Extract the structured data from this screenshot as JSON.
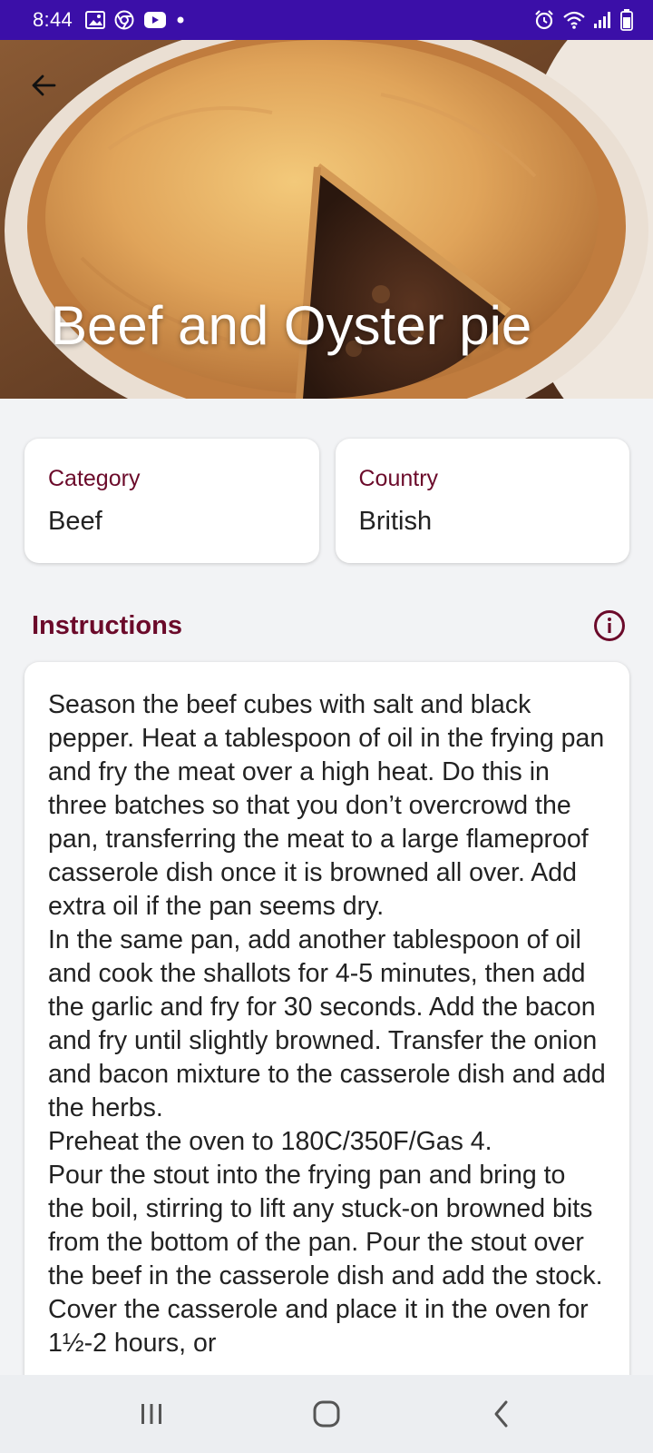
{
  "status_bar": {
    "time": "8:44",
    "left_icons": [
      "image-icon",
      "chrome-icon",
      "youtube-icon",
      "dot-icon"
    ],
    "right_icons": [
      "alarm-icon",
      "wifi-icon",
      "signal-icon",
      "battery-icon"
    ]
  },
  "hero": {
    "title": "Beef and Oyster pie",
    "back_icon": "arrow-left-icon"
  },
  "info_cards": [
    {
      "label": "Category",
      "value": "Beef"
    },
    {
      "label": "Country",
      "value": "British"
    }
  ],
  "instructions": {
    "title": "Instructions",
    "info_icon": "info-circle-icon",
    "text": "Season the beef cubes with salt and black pepper. Heat a tablespoon of oil in the frying pan and fry the meat over a high heat. Do this in three batches so that you don’t overcrowd the pan, transferring the meat to a large flameproof casserole dish once it is browned all over. Add extra oil if the pan seems dry.\nIn the same pan, add another tablespoon of oil and cook the shallots for 4-5 minutes, then add the garlic and fry for 30 seconds. Add the bacon and fry until slightly browned. Transfer the onion and bacon mixture to the casserole dish and add the herbs.\nPreheat the oven to 180C/350F/Gas 4.\nPour the stout into the frying pan and bring to the boil, stirring to lift any stuck-on browned bits from the bottom of the pan. Pour the stout over the beef in the casserole dish and add the stock. Cover the casserole and place it in the oven for 1½-2 hours, or"
  },
  "nav_bar": {
    "icons": [
      "recents-icon",
      "home-icon",
      "back-icon"
    ]
  },
  "colors": {
    "status_bar": "#3b0fa8",
    "accent": "#6b0a2a",
    "background": "#f2f3f5"
  }
}
